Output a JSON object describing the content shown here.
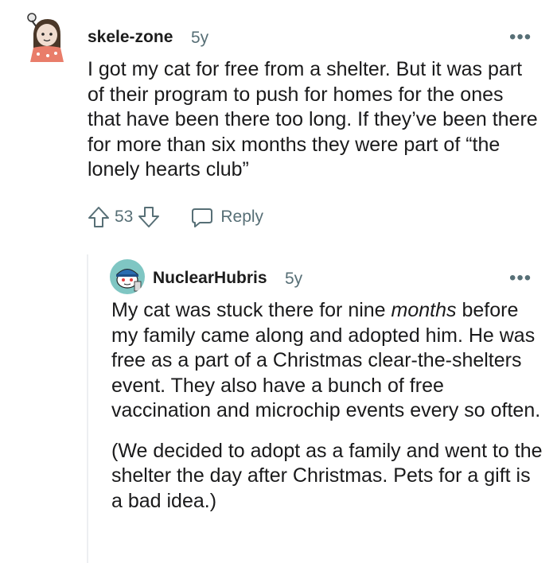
{
  "comment": {
    "username": "skele-zone",
    "age": "5y",
    "more_label": "•••",
    "body": "I got my cat for free from a shelter. But it was part of their program to push for homes for the ones that have been there too long. If they’ve been there for more than six months they were part of “the lonely hearts club”",
    "votes": "53",
    "reply_label": "Reply"
  },
  "reply": {
    "username": "NuclearHubris",
    "age": "5y",
    "more_label": "•••",
    "paragraph1_before": "My cat was stuck there for nine ",
    "paragraph1_em": "months",
    "paragraph1_after": " before my family came along and adopted him. He was free as a part of a Christmas clear-the-shelters event. They also have a bunch of free vaccination and microchip events every so often.",
    "paragraph2": "(We decided to adopt as a family and went to the shelter the day after Christmas. Pets for a gift is a bad idea.)"
  },
  "colors": {
    "meta": "#576f76",
    "thread_line": "#edeff1",
    "reply_avatar_bg": "#7fc6c3"
  },
  "icons": [
    "upvote-icon",
    "downvote-icon",
    "comment-bubble-icon"
  ]
}
